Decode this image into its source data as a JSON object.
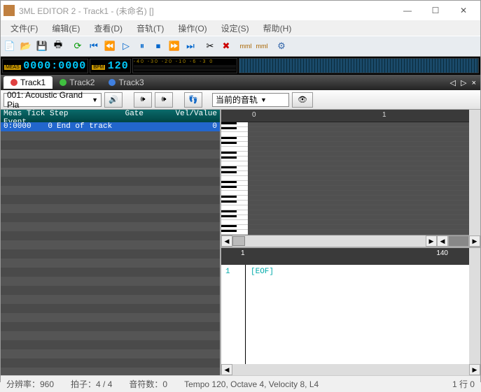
{
  "window": {
    "title": "3ML EDITOR 2 - Track1 - (未命名) []"
  },
  "menu": [
    "文件(F)",
    "编辑(E)",
    "查看(D)",
    "音轨(T)",
    "操作(O)",
    "设定(S)",
    "帮助(H)"
  ],
  "counter": {
    "meas_label": "MEAS",
    "meas": "0000:0000",
    "bpm_label": "BPM",
    "bpm": "120"
  },
  "levels": {
    "ticks": "-40  -30  -20 -10 -6 -3  0"
  },
  "tracks": [
    {
      "label": "Track1",
      "color": "#e04040"
    },
    {
      "label": "Track2",
      "color": "#40c040"
    },
    {
      "label": "Track3",
      "color": "#4080e0"
    }
  ],
  "instrument": {
    "name": "001: Acoustic Grand Pia"
  },
  "toolbar2": {
    "current_track": "当前的音轨"
  },
  "event_header": {
    "c1": "Meas Tick Step Event",
    "c2": "Gate",
    "c3": "Vel/Value"
  },
  "events": [
    {
      "pos": "0:0000",
      "step": "0",
      "name": "End of track",
      "val": "0"
    }
  ],
  "ruler": {
    "m0": "0",
    "m1": "1"
  },
  "bottom": {
    "line": "1",
    "eof": "[EOF]",
    "m1": "1",
    "m140": "140"
  },
  "status": {
    "res": "分辨率：960",
    "beat": "拍子：4 / 4",
    "notes": "音符数：0",
    "tempo": "Tempo 120, Octave 4, Velocity  8, L4",
    "lines": "1 行 0"
  }
}
